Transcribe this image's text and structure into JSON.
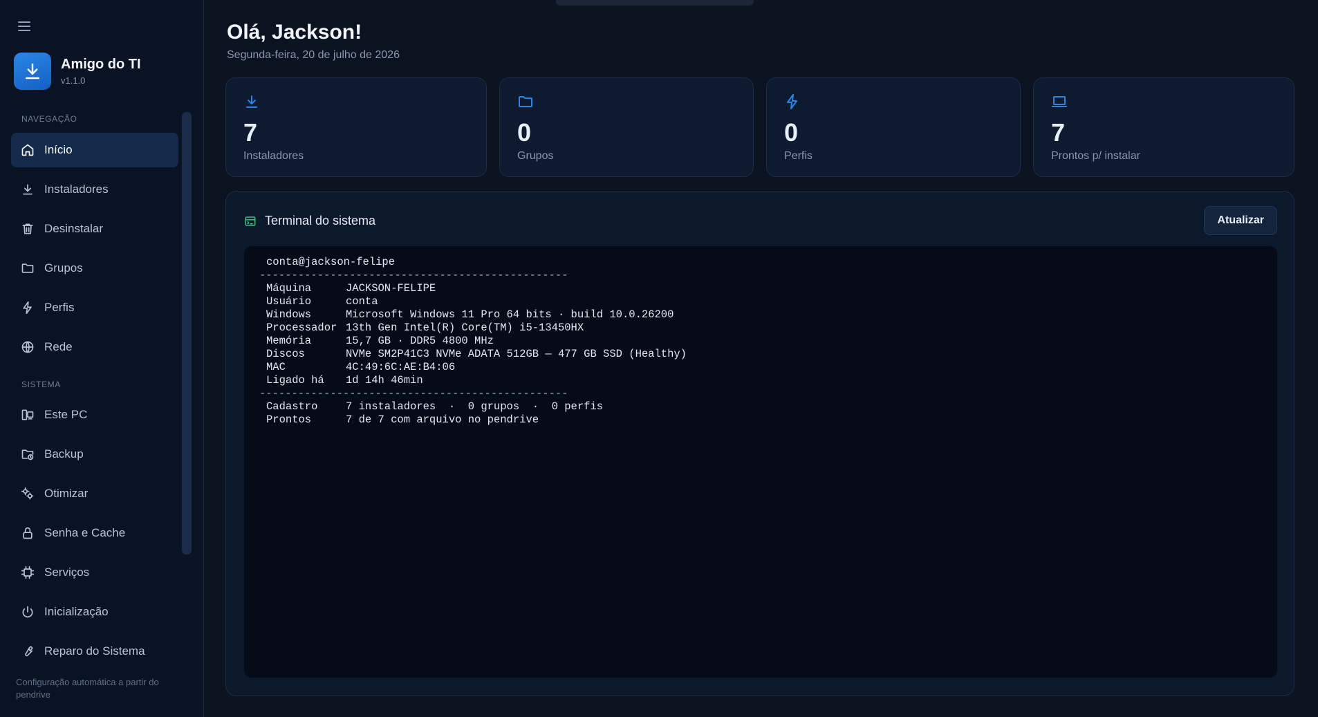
{
  "app": {
    "name": "Amigo do TI",
    "version": "v1.1.0",
    "footer_note": "Configuração automática a partir do pendrive"
  },
  "sidebar": {
    "section_nav": "NAVEGAÇÃO",
    "section_system": "SISTEMA",
    "nav_items": [
      {
        "label": "Início",
        "icon": "home-icon",
        "active": true
      },
      {
        "label": "Instaladores",
        "icon": "download-icon"
      },
      {
        "label": "Desinstalar",
        "icon": "trash-icon"
      },
      {
        "label": "Grupos",
        "icon": "folder-icon"
      },
      {
        "label": "Perfis",
        "icon": "bolt-icon"
      },
      {
        "label": "Rede",
        "icon": "globe-icon"
      }
    ],
    "system_items": [
      {
        "label": "Este PC",
        "icon": "pc-icon"
      },
      {
        "label": "Backup",
        "icon": "backup-folder-icon"
      },
      {
        "label": "Otimizar",
        "icon": "gears-icon"
      },
      {
        "label": "Senha e Cache",
        "icon": "lock-icon"
      },
      {
        "label": "Serviços",
        "icon": "chip-icon"
      },
      {
        "label": "Inicialização",
        "icon": "power-icon"
      },
      {
        "label": "Reparo do Sistema",
        "icon": "wrench-icon"
      }
    ]
  },
  "header": {
    "greeting": "Olá, Jackson!",
    "date": "Segunda-feira, 20 de julho de 2026"
  },
  "stats": [
    {
      "value": "7",
      "label": "Instaladores",
      "icon": "download-icon"
    },
    {
      "value": "0",
      "label": "Grupos",
      "icon": "folder-icon"
    },
    {
      "value": "0",
      "label": "Perfis",
      "icon": "bolt-icon"
    },
    {
      "value": "7",
      "label": "Prontos p/ instalar",
      "icon": "laptop-icon"
    }
  ],
  "terminal": {
    "title": "Terminal do sistema",
    "refresh_label": "Atualizar",
    "prompt": "conta@jackson-felipe",
    "separator": "------------------------------------------------",
    "rows": [
      {
        "key": "Máquina",
        "value": "JACKSON-FELIPE"
      },
      {
        "key": "Usuário",
        "value": "conta"
      },
      {
        "key": "Windows",
        "value": "Microsoft Windows 11 Pro 64 bits · build 10.0.26200"
      },
      {
        "key": "Processador",
        "value": "13th Gen Intel(R) Core(TM) i5-13450HX"
      },
      {
        "key": "Memória",
        "value": "15,7 GB · DDR5 4800 MHz"
      },
      {
        "key": "Discos",
        "value": "NVMe SM2P41C3 NVMe ADATA 512GB — 477 GB SSD (Healthy)"
      },
      {
        "key": "MAC",
        "value": "4C:49:6C:AE:B4:06"
      },
      {
        "key": "Ligado há",
        "value": "1d 14h 46min"
      }
    ],
    "summary": [
      {
        "key": "Cadastro",
        "value": "7 instaladores  ·  0 grupos  ·  0 perfis"
      },
      {
        "key": "Prontos",
        "value": "7 de 7 com arquivo no pendrive"
      }
    ]
  },
  "colors": {
    "accent": "#2a86e6",
    "terminal_icon": "#3fbf7f",
    "background": "#0b1220"
  }
}
